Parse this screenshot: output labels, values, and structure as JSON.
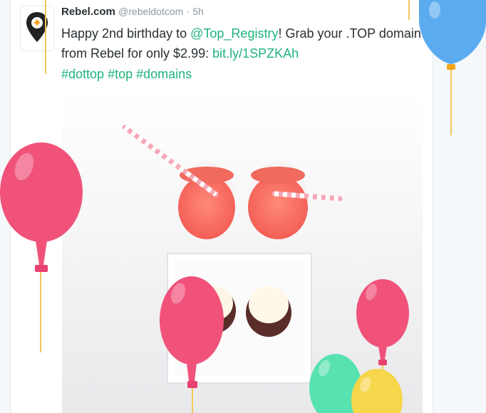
{
  "tweet": {
    "name": "Rebel.com",
    "handle": "@rebeldotcom",
    "separator": "·",
    "time": "5h",
    "text_part1": "Happy 2nd birthday to ",
    "mention": "@Top_Registry",
    "text_part2": "! Grab your .TOP domain from Rebel for only $2.99: ",
    "url": "bit.ly/1SPZKAh",
    "hashtags": [
      "#dottop",
      "#top",
      "#domains"
    ]
  },
  "colors": {
    "link": "#1fb37b",
    "balloon_pink": "#f0527a",
    "balloon_blue": "#5aabf0",
    "balloon_green": "#58e2b0",
    "balloon_yellow": "#f6d64a"
  },
  "icons": {
    "avatar": "rebel-logo-icon"
  },
  "photo": {
    "description_icon": "drinks-and-cupcakes-photo"
  }
}
